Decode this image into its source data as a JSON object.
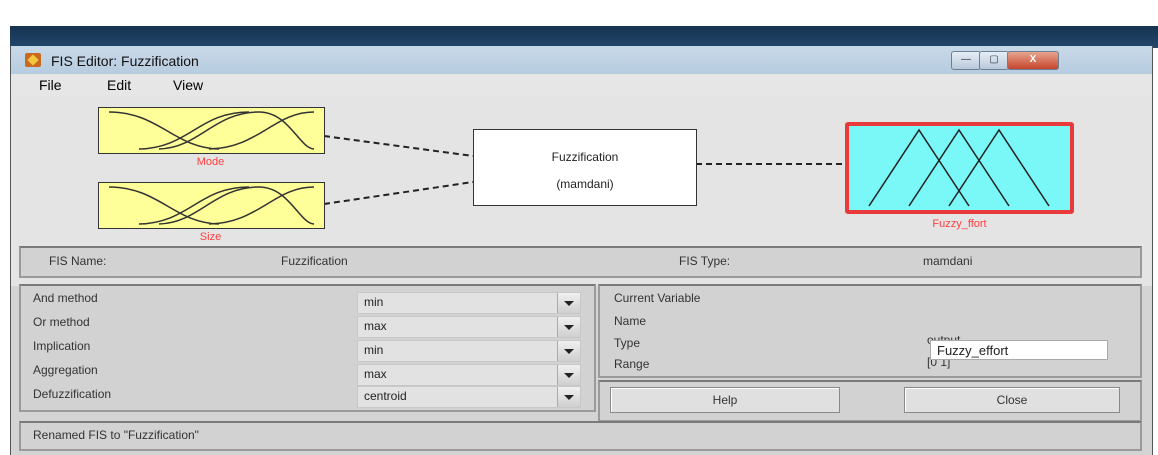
{
  "window": {
    "title": "FIS Editor: Fuzzification",
    "min_label": "—",
    "max_label": "▢",
    "close_label": "X"
  },
  "menu": [
    "File",
    "Edit",
    "View"
  ],
  "diagram": {
    "inputs": [
      {
        "name": "Mode"
      },
      {
        "name": "Size"
      }
    ],
    "system": {
      "name": "Fuzzification",
      "type": "(mamdani)"
    },
    "output": {
      "name": "Fuzzy_ffort"
    }
  },
  "info": {
    "fis_name_label": "FIS Name:",
    "fis_name_value": "Fuzzification",
    "fis_type_label": "FIS Type:",
    "fis_type_value": "mamdani"
  },
  "methods": [
    {
      "label": "And method",
      "value": "min"
    },
    {
      "label": "Or method",
      "value": "max"
    },
    {
      "label": "Implication",
      "value": "min"
    },
    {
      "label": "Aggregation",
      "value": "max"
    },
    {
      "label": "Defuzzification",
      "value": "centroid"
    }
  ],
  "current_variable": {
    "heading": "Current Variable",
    "name_label": "Name",
    "name_value": "Fuzzy_effort",
    "type_label": "Type",
    "type_value": "output",
    "range_label": "Range",
    "range_value": "[0 1]"
  },
  "buttons": {
    "help": "Help",
    "close": "Close"
  },
  "status": "Renamed FIS to \"Fuzzification\"",
  "colors": {
    "input_fill": "#ffff99",
    "output_fill": "#7af7f7",
    "selected_border": "#e83a3a",
    "label_red": "#ff4040"
  }
}
